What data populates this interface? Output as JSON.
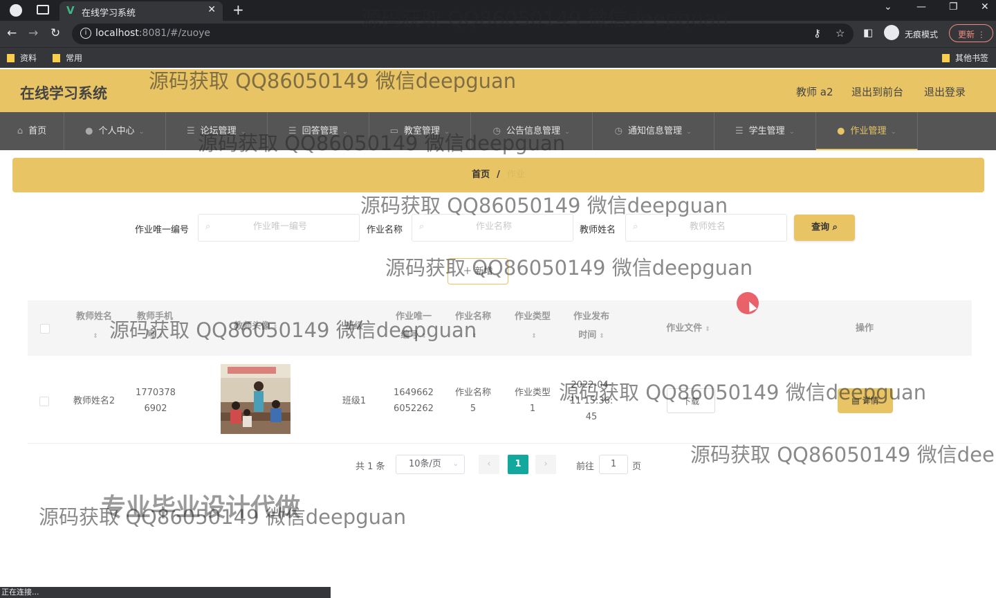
{
  "browser": {
    "tab_title": "在线学习系统",
    "url_host": "localhost",
    "url_rest": ":8081/#/zuoye",
    "incognito_label": "无痕模式",
    "update_label": "更新",
    "bookmarks": [
      "资料",
      "常用"
    ],
    "other_bookmarks": "其他书签",
    "status_text": "正在连接..."
  },
  "header": {
    "title": "在线学习系统",
    "user_label": "教师 a2",
    "back_front": "退出到前台",
    "logout": "退出登录"
  },
  "nav": {
    "items": [
      {
        "label": "首页",
        "icon": "home-icon"
      },
      {
        "label": "个人中心",
        "icon": "user-icon"
      },
      {
        "label": "论坛管理",
        "icon": "list-icon"
      },
      {
        "label": "回答管理",
        "icon": "list-icon"
      },
      {
        "label": "教室管理",
        "icon": "monitor-icon"
      },
      {
        "label": "公告信息管理",
        "icon": "clock-icon"
      },
      {
        "label": "通知信息管理",
        "icon": "clock-icon"
      },
      {
        "label": "学生管理",
        "icon": "list-icon"
      },
      {
        "label": "作业管理",
        "icon": "user-icon"
      }
    ],
    "active_index": 8
  },
  "breadcrumb": {
    "home": "首页",
    "separator": "/",
    "current": "作业"
  },
  "search": {
    "fields": [
      {
        "label": "作业唯一编号",
        "placeholder": "作业唯一编号"
      },
      {
        "label": "作业名称",
        "placeholder": "作业名称"
      },
      {
        "label": "教师姓名",
        "placeholder": "教师姓名"
      }
    ],
    "query_label": "查询"
  },
  "actions": {
    "add_label": "新增"
  },
  "table": {
    "headers": {
      "teacher_name": "教师姓名",
      "teacher_phone_1": "教师手机",
      "teacher_phone_2": "号",
      "teacher_photo": "教师头像",
      "class_name": "班级",
      "hw_id_1": "作业唯一",
      "hw_id_2": "编号",
      "hw_name": "作业名称",
      "hw_type": "作业类型",
      "hw_time_1": "作业发布",
      "hw_time_2": "时间",
      "hw_file": "作业文件",
      "ops": "操作"
    },
    "rows": [
      {
        "teacher_name": "教师姓名2",
        "teacher_phone_1": "1770378",
        "teacher_phone_2": "6902",
        "class_name": "班级1",
        "hw_id_1": "1649662",
        "hw_id_2": "6052262",
        "hw_name_1": "作业名称",
        "hw_name_2": "5",
        "hw_type_1": "作业类型",
        "hw_type_2": "1",
        "hw_time_1": "2022-04-",
        "hw_time_2": "11 15:36:",
        "hw_time_3": "45",
        "download_label": "下载",
        "detail_label": "详情"
      }
    ]
  },
  "pagination": {
    "total": "共 1 条",
    "page_size": "10条/页",
    "current_page": "1",
    "goto_label": "前往",
    "goto_value": "1",
    "page_suffix": "页"
  },
  "overlay": {
    "watermark": "源码获取 QQ86050149 微信deepguan",
    "watermark_cut": "源码获取 QQ86050149 微信dee",
    "promo": "专业毕业设计代做"
  },
  "colors": {
    "accent": "#e8c465",
    "nav_bg": "#555555",
    "pager_active": "#13a89e"
  }
}
